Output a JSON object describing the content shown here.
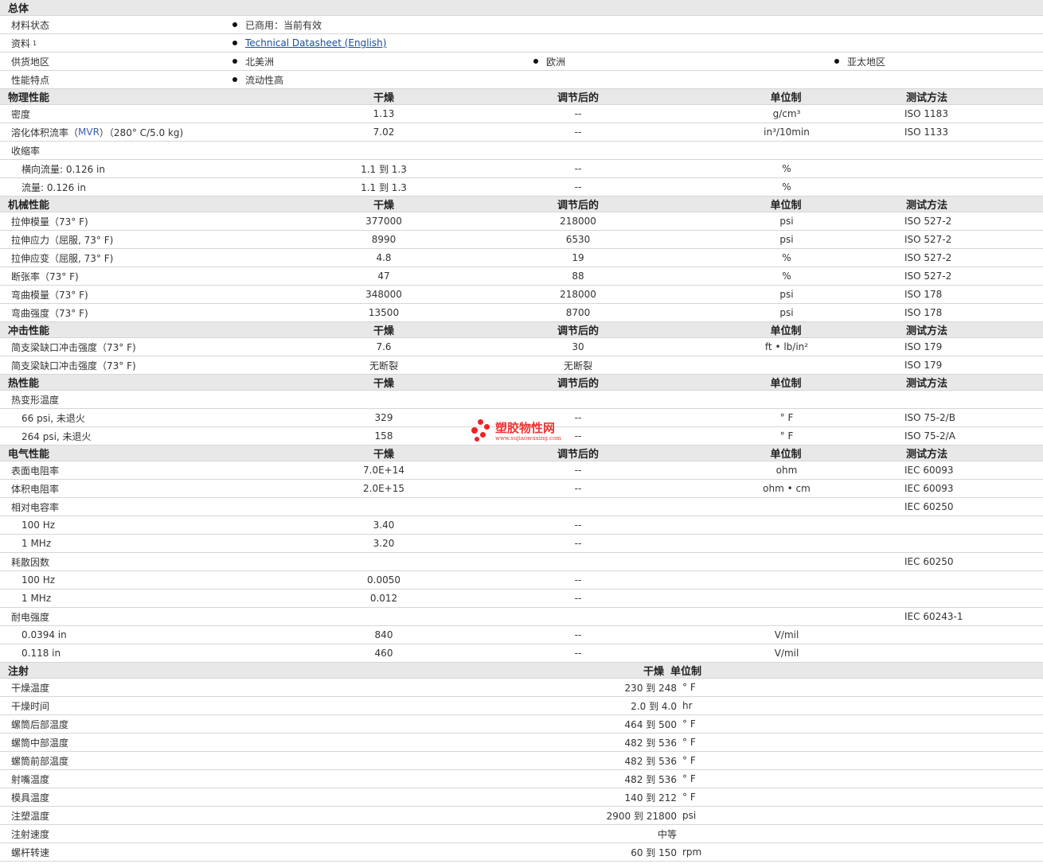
{
  "general": {
    "title": "总体",
    "rows": [
      {
        "label": "材料状态",
        "items": [
          "已商用：当前有效"
        ]
      },
      {
        "label": "资料",
        "sup": "1",
        "link": "Technical Datasheet (English)"
      },
      {
        "label": "供货地区",
        "items": [
          "北美洲",
          "欧洲",
          "亚太地区"
        ]
      },
      {
        "label": "性能特点",
        "items": [
          "流动性高"
        ]
      }
    ]
  },
  "col_headers": {
    "dry": "干燥",
    "conditioned": "调节后的",
    "unit": "单位制",
    "method": "测试方法"
  },
  "sections": [
    {
      "title": "物理性能",
      "rows": [
        {
          "label": "密度",
          "dry": "1.13",
          "cond": "--",
          "unit": "g/cm³",
          "method": "ISO 1183"
        },
        {
          "label": "溶化体积流率（",
          "mvr": "MVR",
          "label_suffix": "）（280° C/5.0 kg)",
          "dry": "7.02",
          "cond": "--",
          "unit": "in³/10min",
          "method": "ISO 1133"
        },
        {
          "label": "收缩率"
        },
        {
          "label": "横向流量: 0.126 in",
          "indent": true,
          "dry": "1.1 到  1.3",
          "cond": "--",
          "unit": "%"
        },
        {
          "label": "流量: 0.126 in",
          "indent": true,
          "dry": "1.1 到  1.3",
          "cond": "--",
          "unit": "%"
        }
      ]
    },
    {
      "title": "机械性能",
      "rows": [
        {
          "label": "拉伸模量（73° F)",
          "dry": "377000",
          "cond": "218000",
          "unit": "psi",
          "method": "ISO 527-2"
        },
        {
          "label": "拉伸应力（屈服, 73° F)",
          "dry": "8990",
          "cond": "6530",
          "unit": "psi",
          "method": "ISO 527-2"
        },
        {
          "label": "拉伸应变（屈服, 73° F)",
          "dry": "4.8",
          "cond": "19",
          "unit": "%",
          "method": "ISO 527-2"
        },
        {
          "label": "断张率（73° F)",
          "dry": "47",
          "cond": "88",
          "unit": "%",
          "method": "ISO 527-2"
        },
        {
          "label": "弯曲模量（73° F)",
          "dry": "348000",
          "cond": "218000",
          "unit": "psi",
          "method": "ISO 178"
        },
        {
          "label": "弯曲强度（73° F)",
          "dry": "13500",
          "cond": "8700",
          "unit": "psi",
          "method": "ISO 178"
        }
      ]
    },
    {
      "title": "冲击性能",
      "rows": [
        {
          "label": "简支梁缺口冲击强度（73° F)",
          "dry": "7.6",
          "cond": "30",
          "unit": "ft • lb/in²",
          "method": "ISO 179"
        },
        {
          "label": "简支梁缺口冲击强度（73° F)",
          "dry": "无断裂",
          "cond": "无断裂",
          "method": "ISO 179"
        }
      ]
    },
    {
      "title": "热性能",
      "rows": [
        {
          "label": "热变形温度"
        },
        {
          "label": "66 psi, 未退火",
          "indent": true,
          "dry": "329",
          "cond": "--",
          "unit": "° F",
          "method": "ISO 75-2/B"
        },
        {
          "label": "264 psi, 未退火",
          "indent": true,
          "dry": "158",
          "cond": "--",
          "unit": "° F",
          "method": "ISO 75-2/A"
        }
      ]
    },
    {
      "title": "电气性能",
      "rows": [
        {
          "label": "表面电阻率",
          "dry": "7.0E+14",
          "cond": "--",
          "unit": "ohm",
          "method": "IEC 60093"
        },
        {
          "label": "体积电阻率",
          "dry": "2.0E+15",
          "cond": "--",
          "unit": "ohm • cm",
          "method": "IEC 60093"
        },
        {
          "label": "相对电容率",
          "method": "IEC 60250"
        },
        {
          "label": "100 Hz",
          "indent": true,
          "dry": "3.40",
          "cond": "--"
        },
        {
          "label": "1 MHz",
          "indent": true,
          "dry": "3.20",
          "cond": "--"
        },
        {
          "label": "耗散因数",
          "method": "IEC 60250"
        },
        {
          "label": "100 Hz",
          "indent": true,
          "dry": "0.0050",
          "cond": "--"
        },
        {
          "label": "1 MHz",
          "indent": true,
          "dry": "0.012",
          "cond": "--"
        },
        {
          "label": "耐电强度",
          "method": "IEC 60243-1"
        },
        {
          "label": "0.0394 in",
          "indent": true,
          "dry": "840",
          "cond": "--",
          "unit": "V/mil"
        },
        {
          "label": "0.118 in",
          "indent": true,
          "dry": "460",
          "cond": "--",
          "unit": "V/mil"
        }
      ]
    }
  ],
  "injection": {
    "title": "注射",
    "headers": {
      "dry": "干燥",
      "unit": "单位制"
    },
    "rows": [
      {
        "label": "干燥温度",
        "value": "230 到  248",
        "unit": "° F"
      },
      {
        "label": "干燥时间",
        "value": "2.0 到  4.0",
        "unit": "hr"
      },
      {
        "label": "螺筒后部温度",
        "value": "464 到  500",
        "unit": "° F"
      },
      {
        "label": "螺筒中部温度",
        "value": "482 到  536",
        "unit": "° F"
      },
      {
        "label": "螺筒前部温度",
        "value": "482 到  536",
        "unit": "° F"
      },
      {
        "label": "射嘴温度",
        "value": "482 到  536",
        "unit": "° F"
      },
      {
        "label": "模具温度",
        "value": "140 到  212",
        "unit": "° F"
      },
      {
        "label": "注塑温度",
        "value": "2900 到  21800",
        "unit": "psi"
      },
      {
        "label": "注射速度",
        "value": "中等"
      },
      {
        "label": "螺杆转速",
        "value": "60 到  150",
        "unit": "rpm"
      }
    ]
  },
  "watermark": {
    "title": "塑胶物性网",
    "url": "www.sujiaowuxing.com"
  },
  "colors": {
    "header_bg": "#e8e8e8",
    "link": "#1a4c9c",
    "watermark": "#e33333"
  }
}
